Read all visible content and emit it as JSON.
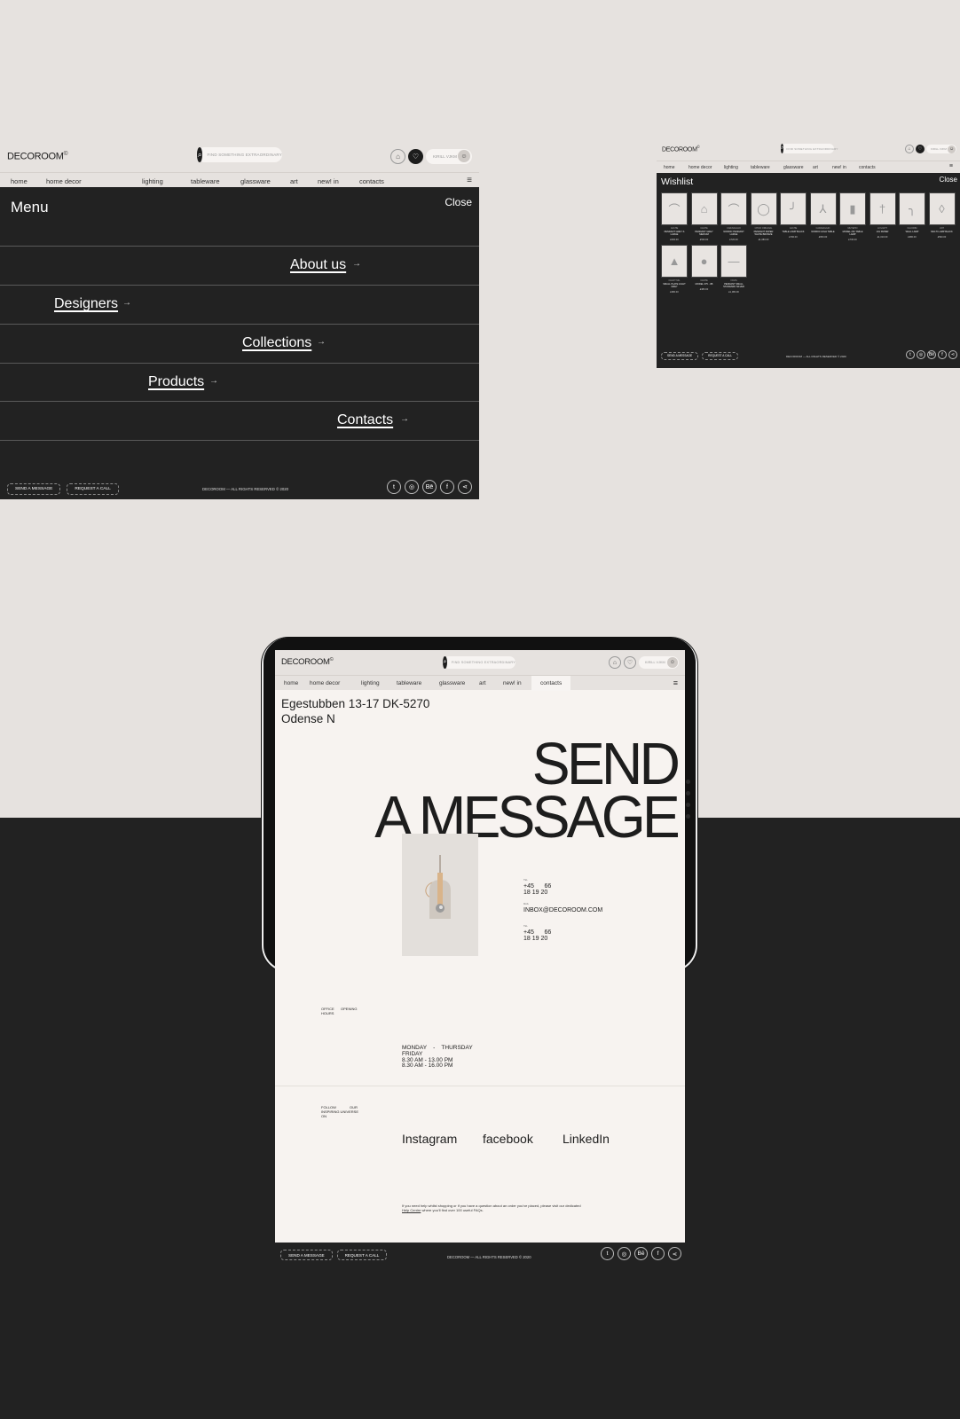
{
  "site": {
    "logo": "DECOROOM",
    "logo_mark": "©",
    "search_placeholder": "FIND SOMETHING EXTRAORDINARY",
    "user_name": "KIRILL VJKM",
    "nav": [
      "home",
      "home decor",
      "lighting",
      "tableware",
      "glassware",
      "art",
      "new! in",
      "contacts"
    ],
    "icons": {
      "search": "search-icon",
      "bag": "bag-icon",
      "heart": "heart-icon",
      "burger": "hamburger-menu-icon",
      "avatar": "user-avatar"
    }
  },
  "footer": {
    "send_message": "SEND A MESSAGE",
    "request_call": "REQUEST A CALL",
    "copyright": "DECOROOM — ALL RIGHTS RESERVED © 2020",
    "socials": [
      {
        "name": "twitter",
        "glyph": "t"
      },
      {
        "name": "instagram",
        "glyph": "◎"
      },
      {
        "name": "behance",
        "glyph": "Bē"
      },
      {
        "name": "facebook",
        "glyph": "f"
      },
      {
        "name": "share",
        "glyph": "⋖"
      }
    ]
  },
  "menu": {
    "title": "Menu",
    "close": "Close",
    "items": [
      {
        "label": "About us",
        "arrow": "→"
      },
      {
        "label": "Designers",
        "arrow": "→"
      },
      {
        "label": "Collections",
        "arrow": "→"
      },
      {
        "label": "Products",
        "arrow": "→"
      },
      {
        "label": "Contacts",
        "arrow": "→"
      }
    ]
  },
  "wishlist": {
    "title": "Wishlist",
    "close": "Close",
    "items": [
      {
        "brand": "CACHE",
        "name": "PENDANT GREY S LARGE",
        "price": "£630.00"
      },
      {
        "brand": "CACHE",
        "name": "PENDANT GREY MEDIUM",
        "price": "£530.00"
      },
      {
        "brand": "CARAVAGGIO",
        "name": "NORDIC PENDANT LARGE",
        "price": "£720.00"
      },
      {
        "brand": "CHICO ORIGINAL",
        "name": "PENDANT PAPER WHITE BRONZE",
        "price": "£1,080.00"
      },
      {
        "brand": "CACHE",
        "name": "TABLE LAMP BLACK",
        "price": "£790.00"
      },
      {
        "brand": "CARAVAGGIO",
        "name": "NORDIC HIGH TABLE",
        "price": "£650.00"
      },
      {
        "brand": "MUTEPIO",
        "name": "MODEL 201 TABLE LAMP",
        "price": "£730.00"
      },
      {
        "brand": "LIVLIGHT",
        "name": "101 PAPER",
        "price": "£1,010.00"
      },
      {
        "brand": "FLUORIM",
        "name": "WALL LAMP",
        "price": "£980.00"
      },
      {
        "brand": "UNT",
        "name": "MULTI LAMP BLACK",
        "price": "£590.00"
      },
      {
        "brand": "FAGOT MIL",
        "name": "SMALL PLATE LIGHT GREY",
        "price": "£380.00"
      },
      {
        "brand": "CACHE",
        "name": "MODEL 375 - 3B",
        "price": "£380.00"
      },
      {
        "brand": "VOLTA",
        "name": "PENDANT SMALL STANDARD SILVER",
        "price": "£1,080.00"
      }
    ]
  },
  "contacts": {
    "address_line1": "Egestubben 13-17 DK-5270",
    "address_line2": "Odense N",
    "heading_line1": "SEND",
    "heading_line2": "A MESSAGE",
    "phone_label": "TEL",
    "phone_1": "+45      66",
    "phone_2": "18 19 20",
    "email_label": "MAIL",
    "email": "INBOX@DECOROOM.COM",
    "phone2_label": "TEL",
    "phone2_1": "+45      66",
    "phone2_2": "18 19 20",
    "office_label_1": "OFFICE",
    "office_label_2": "OPENING",
    "office_label_3": "HOURS",
    "hours_1_days": "MONDAY    -    THURSDAY",
    "hours_1_time": "8.30 AM - 16.00 PM",
    "hours_2_days": "FRIDAY",
    "hours_2_time": "8.30 AM - 13.00 PM",
    "follow_1": "FOLLOW",
    "follow_2": "OUR",
    "follow_3": "INSPIRING UNIVERSE",
    "follow_4": "ON",
    "social_links": [
      "Instagram",
      "facebook",
      "LinkedIn"
    ],
    "help_text": "If you need help whilst shopping or if you have a question about an order you've placed, please visit our dedicated",
    "help_link": "Help Centre",
    "help_text_2": "where you'll find over 100 useful FAQs.",
    "active_nav": "contacts"
  }
}
